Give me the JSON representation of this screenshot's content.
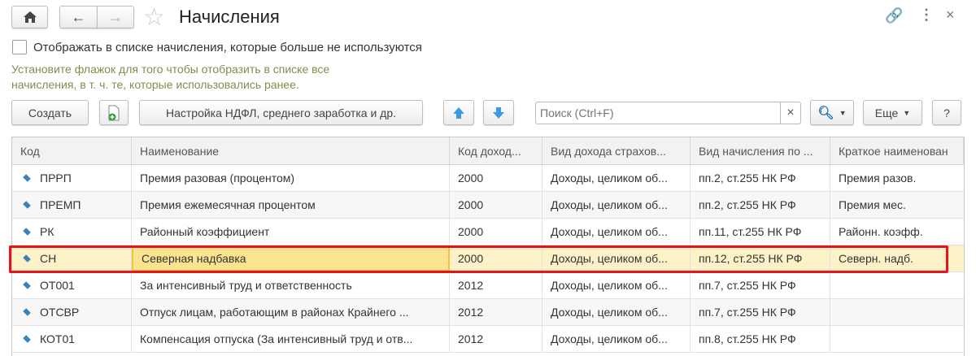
{
  "header": {
    "title": "Начисления"
  },
  "filter": {
    "checkbox_label": "Отображать в списке начисления, которые больше не используются",
    "checked": false,
    "hint_line1": "Установите флажок для того чтобы отобразить в списке все",
    "hint_line2": "начисления, в т. ч. те, которые использовались ранее."
  },
  "toolbar": {
    "create": "Создать",
    "ndfl_settings": "Настройка НДФЛ, среднего заработка и др.",
    "search_placeholder": "Поиск (Ctrl+F)",
    "clear": "×",
    "more": "Еще",
    "help": "?"
  },
  "table": {
    "columns": [
      "Код",
      "Наименование",
      "Код доход...",
      "Вид дохода страхов...",
      "Вид начисления по ...",
      "Краткое наименован"
    ],
    "rows": [
      [
        "ПРРП",
        "Премия разовая (процентом)",
        "2000",
        "Доходы, целиком об...",
        "пп.2, ст.255 НК РФ",
        "Премия разов."
      ],
      [
        "ПРЕМП",
        "Премия ежемесячная процентом",
        "2000",
        "Доходы, целиком об...",
        "пп.2, ст.255 НК РФ",
        "Премия мес."
      ],
      [
        "РК",
        "Районный коэффициент",
        "2000",
        "Доходы, целиком об...",
        "пп.11, ст.255 НК РФ",
        "Районн. коэфф."
      ],
      [
        "СН",
        "Северная надбавка",
        "2000",
        "Доходы, целиком об...",
        "пп.12, ст.255 НК РФ",
        "Северн. надб."
      ],
      [
        "ОТ001",
        "За интенсивный труд и ответственность",
        "2012",
        "Доходы, целиком об...",
        "пп.7, ст.255 НК РФ",
        ""
      ],
      [
        "ОТСВР",
        "Отпуск лицам, работающим в районах Крайнего ...",
        "2012",
        "Доходы, целиком об...",
        "пп.7, ст.255 НК РФ",
        ""
      ],
      [
        "КОТ01",
        "Компенсация отпуска (За интенсивный труд и отв...",
        "2012",
        "Доходы, целиком об...",
        "пп.8, ст.255 НК РФ",
        ""
      ]
    ],
    "selected_row": 3
  }
}
